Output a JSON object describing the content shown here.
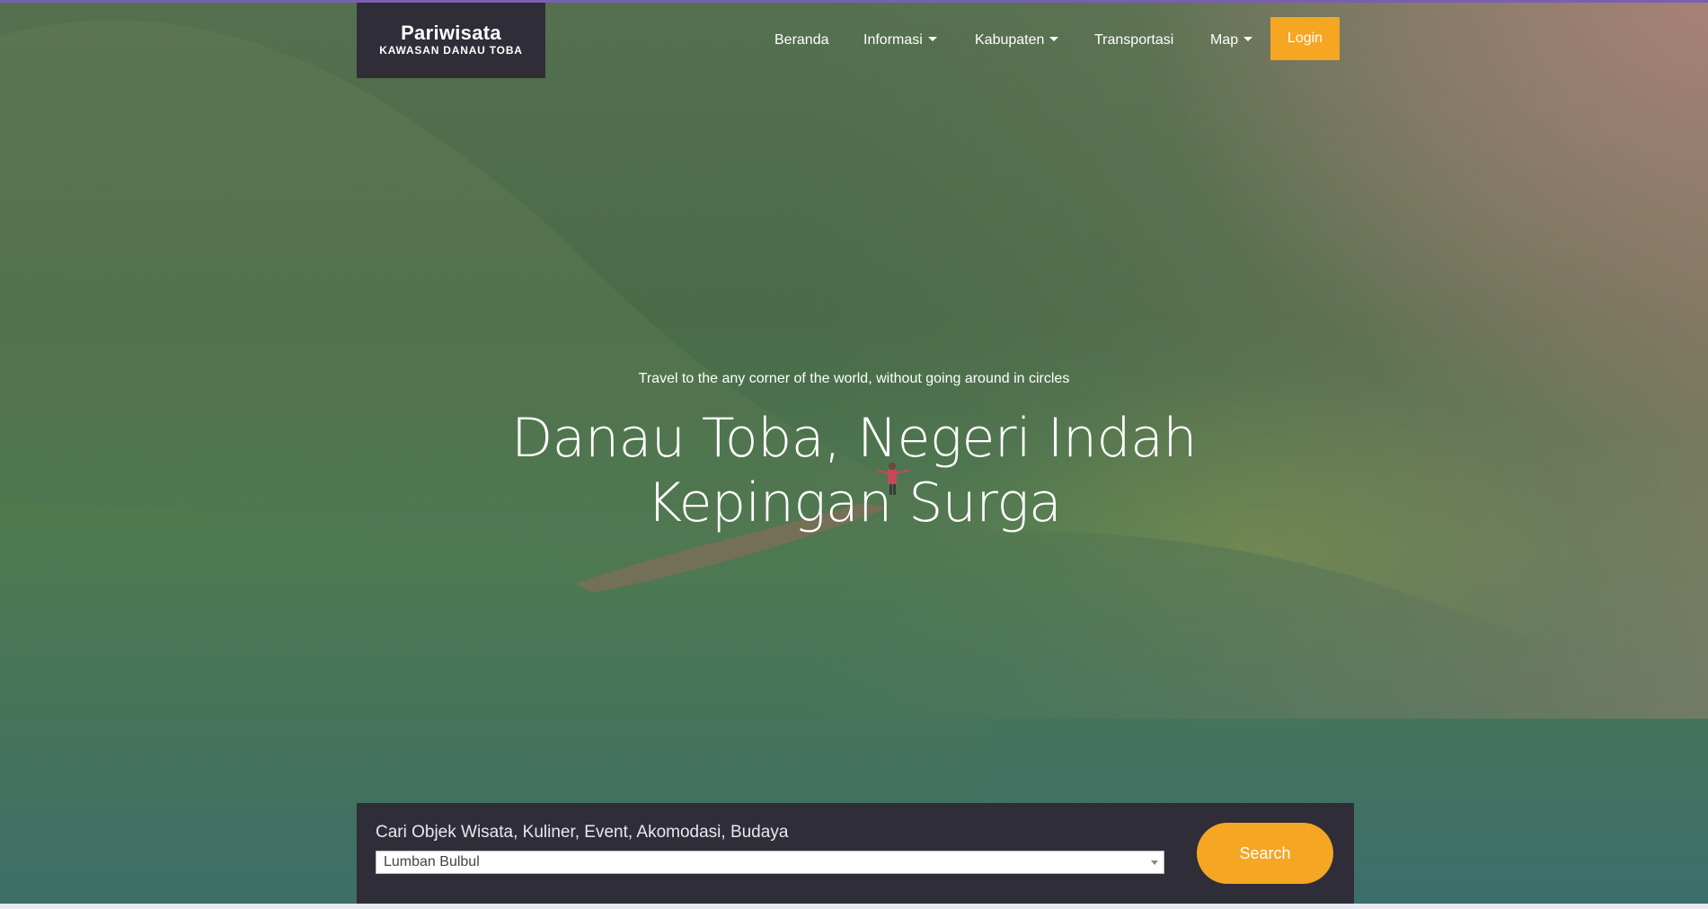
{
  "brand": {
    "title": "Pariwisata",
    "subtitle": "KAWASAN DANAU TOBA"
  },
  "nav": {
    "items": [
      {
        "label": "Beranda",
        "dropdown": false
      },
      {
        "label": "Informasi",
        "dropdown": true
      },
      {
        "label": "Kabupaten",
        "dropdown": true
      },
      {
        "label": "Transportasi",
        "dropdown": false
      },
      {
        "label": "Map",
        "dropdown": true
      }
    ],
    "login_label": "Login"
  },
  "hero": {
    "tagline": "Travel to the any corner of the world, without going around in circles",
    "headline_line1": "Danau Toba, Negeri Indah",
    "headline_line2": "Kepingan Surga"
  },
  "search": {
    "label": "Cari Objek Wisata, Kuliner, Event, Akomodasi, Budaya",
    "selected_value": "Lumban Bulbul",
    "button_label": "Search"
  },
  "colors": {
    "accent": "#f5a623",
    "dark_panel": "#2f2d38"
  }
}
